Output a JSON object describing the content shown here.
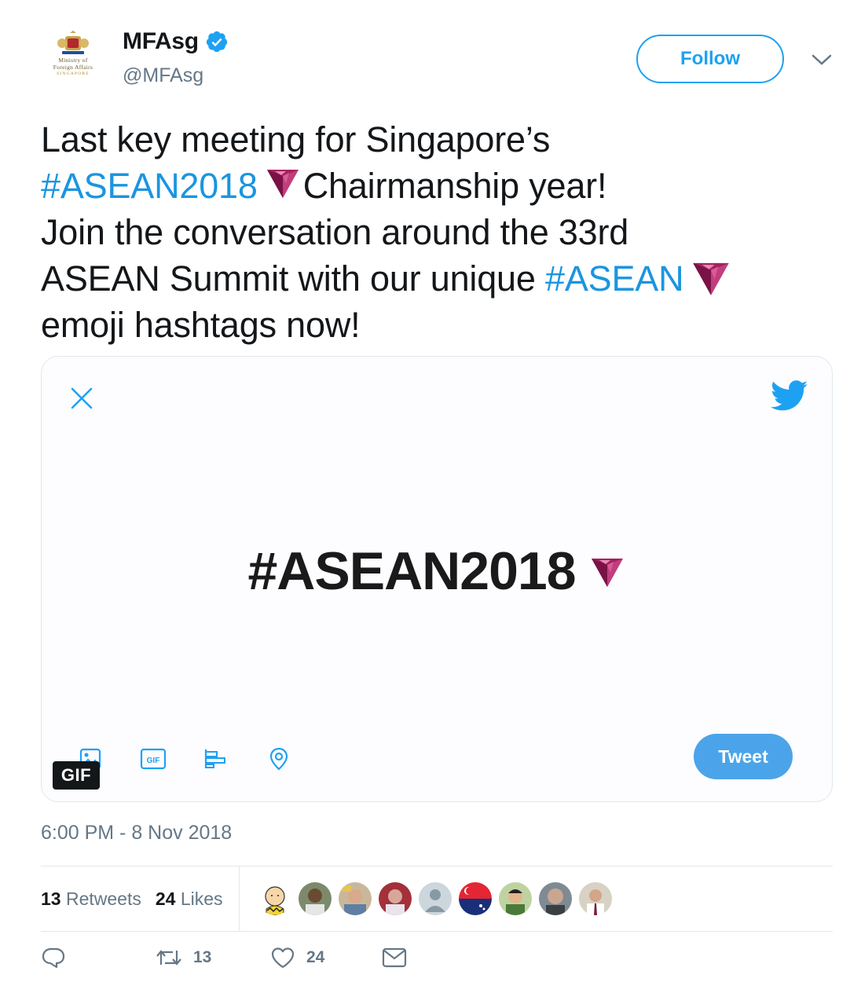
{
  "account": {
    "logo_lines": [
      "Ministry of",
      "Foreign Affairs",
      "SINGAPORE"
    ],
    "display_name": "MFAsg",
    "handle": "@MFAsg",
    "verified": true
  },
  "follow_label": "Follow",
  "tweet": {
    "line1": "Last key meeting for Singapore’s",
    "hashtag1": "#ASEAN2018",
    "line2_rest": "Chairmanship year!",
    "line3": "Join the conversation around the 33rd",
    "line4_pre": "ASEAN Summit with our unique",
    "hashtag2": "#ASEAN",
    "line5": "emoji hashtags now!"
  },
  "media": {
    "center_hashtag": "#ASEAN2018",
    "tweet_button": "Tweet",
    "gif_badge": "GIF",
    "gif_icon_text": "GIF"
  },
  "timestamp": "6:00 PM - 8 Nov 2018",
  "stats": {
    "retweets_count": "13",
    "retweets_label": "Retweets",
    "likes_count": "24",
    "likes_label": "Likes",
    "avatar_count": 9
  },
  "actions": {
    "reply_icon": "reply-icon",
    "retweet_count": "13",
    "like_count": "24",
    "dm_icon": "envelope-icon"
  },
  "colors": {
    "link": "#1b95e0",
    "follow": "#1da1f2",
    "tweet_button": "#4ba4e9",
    "gem": "#a3215f"
  }
}
